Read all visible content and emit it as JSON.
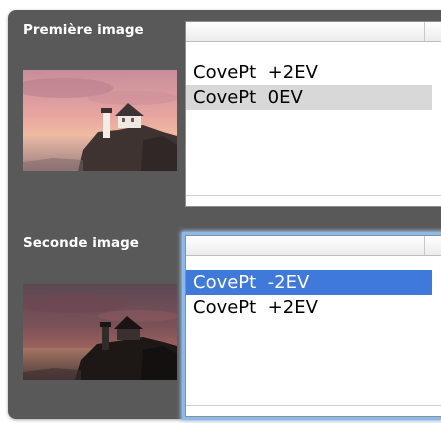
{
  "first": {
    "label": "Première image",
    "items": [
      "CovePt  +2EV",
      "CovePt  0EV"
    ]
  },
  "second": {
    "label": "Seconde image",
    "items": [
      "CovePt  -2EV",
      "CovePt  +2EV"
    ]
  },
  "colors": {
    "panel": "#595959",
    "selection": "#3f79d9",
    "alternate_row": "#d8d8d8",
    "focus_ring": "#8db8ec"
  }
}
